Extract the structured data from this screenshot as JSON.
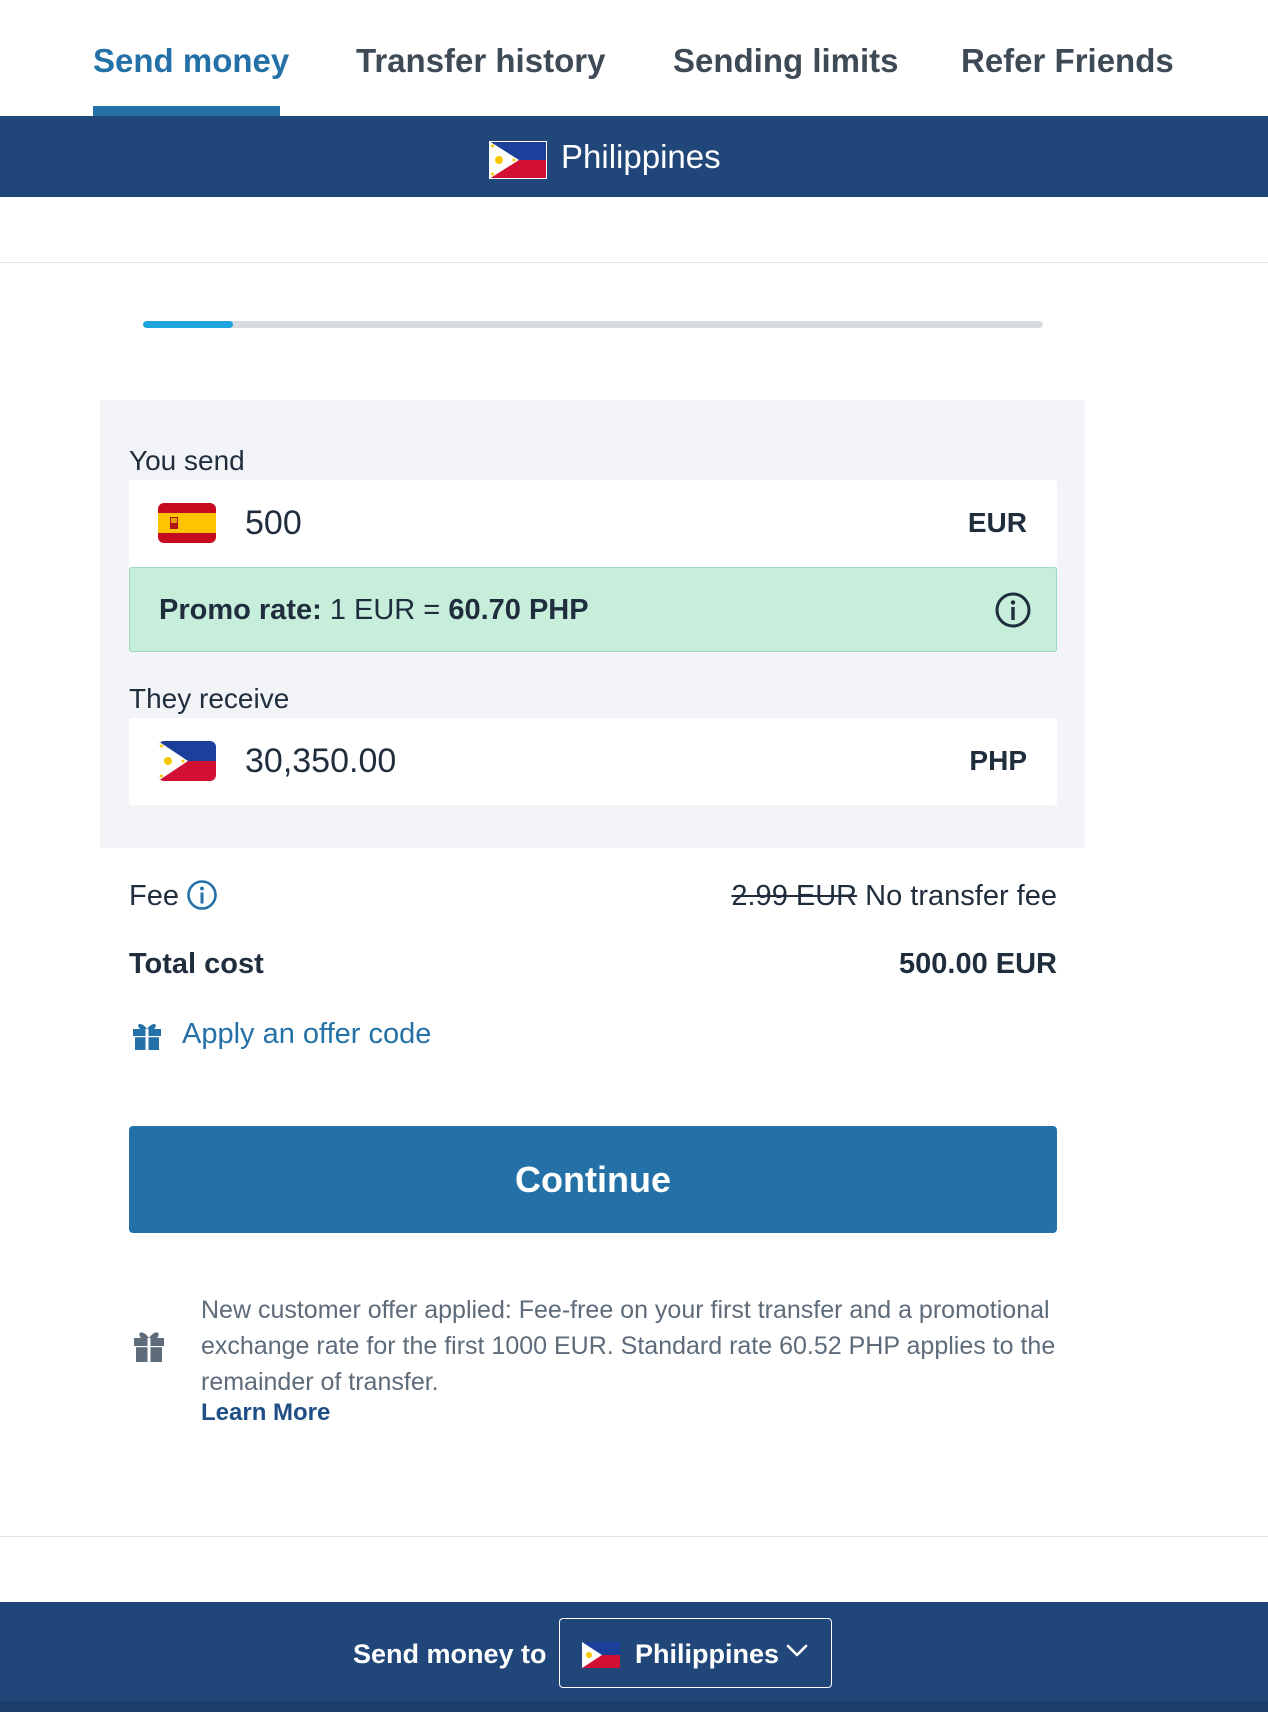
{
  "tabs": [
    {
      "label": "Send money",
      "active": true
    },
    {
      "label": "Transfer history",
      "active": false
    },
    {
      "label": "Sending limits",
      "active": false
    },
    {
      "label": "Refer Friends",
      "active": false
    }
  ],
  "banner": {
    "country": "Philippines",
    "flag_icon": "philippines-flag-icon"
  },
  "progress": {
    "percent": 10
  },
  "send": {
    "label": "You send",
    "amount": "500",
    "currency": "EUR",
    "flag_icon": "spain-flag-icon"
  },
  "promo": {
    "label": "Promo rate:",
    "from": "1 EUR =",
    "to": "60.70 PHP"
  },
  "receive": {
    "label": "They receive",
    "amount": "30,350.00",
    "currency": "PHP",
    "flag_icon": "philippines-flag-icon"
  },
  "fee": {
    "label": "Fee",
    "old_value": "2.99 EUR",
    "value": "No transfer fee"
  },
  "total": {
    "label": "Total cost",
    "value": "500.00 EUR"
  },
  "offer_code": {
    "label": "Apply an offer code",
    "icon": "gift-icon"
  },
  "continue": {
    "label": "Continue"
  },
  "notice": {
    "text": "New customer offer applied: Fee-free on your first transfer and a promotional exchange rate for the first 1000 EUR. Standard rate 60.52 PHP applies to the remainder of transfer.",
    "link": "Learn More",
    "icon": "gift-icon"
  },
  "footer": {
    "label": "Send money to",
    "selected_country": "Philippines"
  },
  "colors": {
    "primary": "#2471a8",
    "navy": "#21467a",
    "progress": "#1ea5df",
    "promo_bg": "#c6eedb",
    "box_bg": "#f2f4f7"
  }
}
